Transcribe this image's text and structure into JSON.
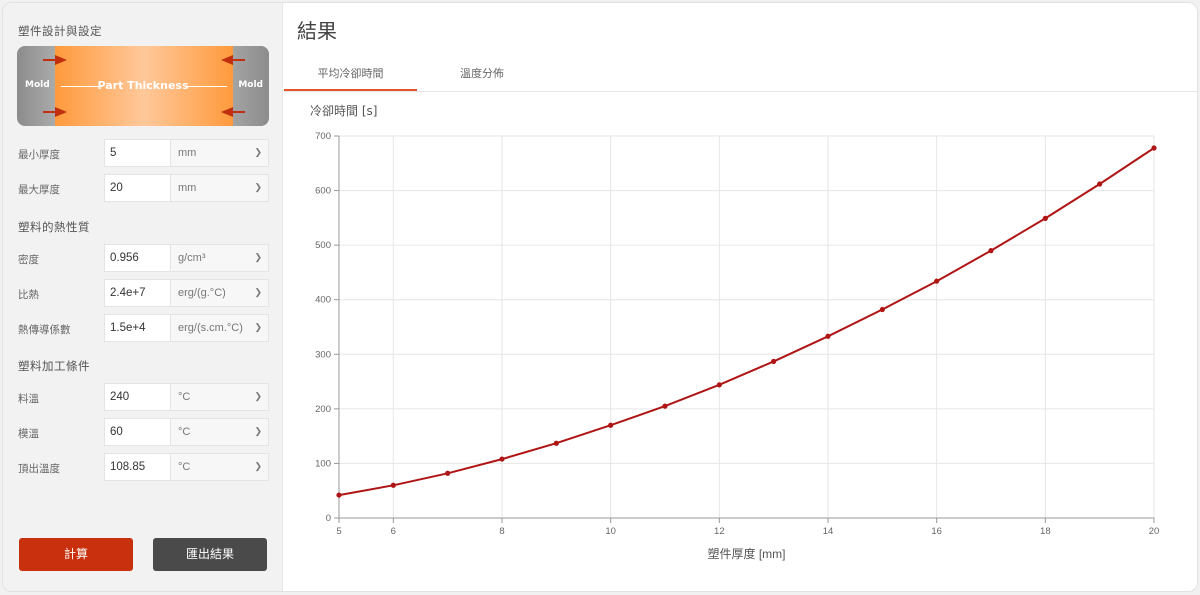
{
  "sidebar": {
    "design_title": "塑件設計與設定",
    "diagram": {
      "mold_left": "Mold",
      "mold_right": "Mold",
      "thickness_label": "Part Thickness"
    },
    "thermal_title": "塑料的熱性質",
    "process_title": "塑料加工條件",
    "fields": [
      {
        "label": "最小厚度",
        "value": "5",
        "unit": "mm"
      },
      {
        "label": "最大厚度",
        "value": "20",
        "unit": "mm"
      },
      {
        "label": "密度",
        "value": "0.956",
        "unit": "g/cm³"
      },
      {
        "label": "比熱",
        "value": "2.4e+7",
        "unit": "erg/(g.°C)"
      },
      {
        "label": "熱傳導係數",
        "value": "1.5e+4",
        "unit": "erg/(s.cm.°C)"
      },
      {
        "label": "料溫",
        "value": "240",
        "unit": "°C"
      },
      {
        "label": "模溫",
        "value": "60",
        "unit": "°C"
      },
      {
        "label": "頂出溫度",
        "value": "108.85",
        "unit": "°C"
      }
    ],
    "calc_button": "計算",
    "export_button": "匯出結果"
  },
  "main": {
    "title": "結果",
    "tabs": [
      {
        "label": "平均冷卻時間",
        "active": true
      },
      {
        "label": "溫度分佈",
        "active": false
      }
    ]
  },
  "colors": {
    "accent": "#c8300e",
    "tab_underline": "#e8552d",
    "line": "#b01515",
    "export_button": "#4a4a4a"
  },
  "chart_data": {
    "type": "line",
    "title": "冷卻時間 [s]",
    "xlabel": "塑件厚度 [mm]",
    "ylabel": "冷卻時間 [s]",
    "xlim": [
      5,
      20
    ],
    "ylim": [
      0,
      700
    ],
    "xticks": [
      5,
      6,
      8,
      10,
      12,
      14,
      16,
      18,
      20
    ],
    "yticks": [
      0,
      100,
      200,
      300,
      400,
      500,
      600,
      700
    ],
    "grid": true,
    "series": [
      {
        "x": [
          5,
          6,
          7,
          8,
          9,
          10,
          11,
          12,
          13,
          14,
          15,
          16,
          17,
          18,
          19,
          20
        ],
        "y": [
          42,
          60,
          82,
          108,
          137,
          170,
          205,
          244,
          287,
          333,
          382,
          434,
          490,
          549,
          612,
          678
        ]
      }
    ]
  }
}
